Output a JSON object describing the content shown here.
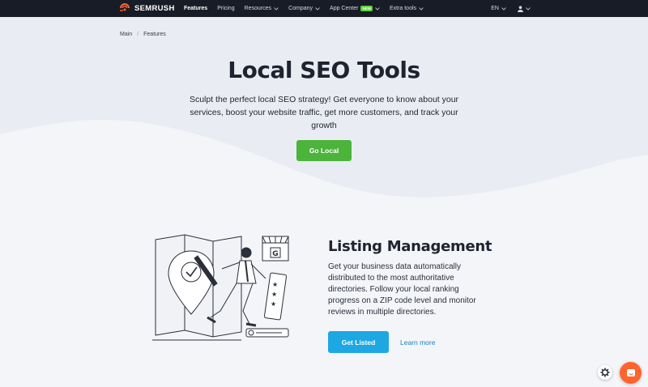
{
  "nav": {
    "brand": "SEMRUSH",
    "links": [
      {
        "label": "Features",
        "active": true
      },
      {
        "label": "Pricing"
      },
      {
        "label": "Resources"
      },
      {
        "label": "Company"
      },
      {
        "label": "App Center",
        "badge": "NEW"
      },
      {
        "label": "Extra tools"
      }
    ],
    "language": "EN"
  },
  "breadcrumb": [
    "Main",
    "Features"
  ],
  "hero": {
    "title": "Local SEO Tools",
    "subtitle": "Sculpt the perfect local SEO strategy! Get everyone to know about your services, boost your website traffic, get more customers, and track your growth",
    "cta": "Go Local"
  },
  "listing": {
    "title": "Listing Management",
    "body": "Get your business data automatically distributed to the most authoritative directories. Follow your local ranking progress on a ZIP code level and monitor reviews in multiple directories.",
    "cta": "Get Listed",
    "link": "Learn more"
  },
  "icons": {
    "brand": "semrush-logo-icon",
    "user": "user-icon",
    "settings": "gear-icon",
    "chat": "chat-icon"
  },
  "colors": {
    "nav_bg": "#181c26",
    "green_cta": "#4cb33b",
    "blue_cta": "#1da8e3",
    "brand_orange": "#ff642d",
    "link": "#1a82c4"
  }
}
